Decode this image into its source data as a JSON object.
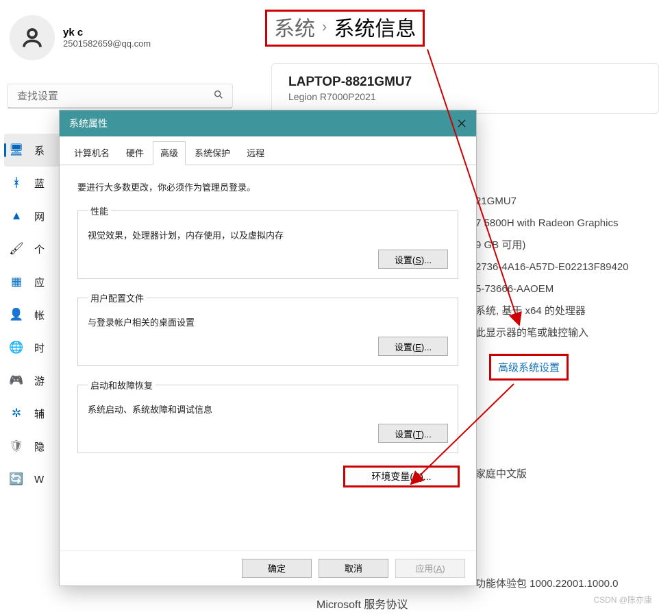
{
  "user": {
    "name": "yk c",
    "email": "2501582659@qq.com"
  },
  "breadcrumb": {
    "parent": "系统",
    "current": "系统信息"
  },
  "search": {
    "placeholder": "查找设置"
  },
  "sidebar": {
    "items": [
      {
        "icon": "💻",
        "label": "系",
        "color": "#0067c0",
        "active": true
      },
      {
        "icon": "B",
        "label": "蓝",
        "color": "#0067c0"
      },
      {
        "icon": "W",
        "label": "网",
        "color": "#0067c0"
      },
      {
        "icon": "🖌",
        "label": "个",
        "color": "#e97627"
      },
      {
        "icon": "▦",
        "label": "应",
        "color": "#0067c0"
      },
      {
        "icon": "👤",
        "label": "帐",
        "color": "#0067c0"
      },
      {
        "icon": "🌐",
        "label": "时",
        "color": "#0067c0"
      },
      {
        "icon": "🎮",
        "label": "游",
        "color": "#666"
      },
      {
        "icon": "✦",
        "label": "辅",
        "color": "#0067c0"
      },
      {
        "icon": "🛡",
        "label": "隐",
        "color": "#777"
      },
      {
        "icon": "🔄",
        "label": "W",
        "color": "#0067c0"
      }
    ]
  },
  "card": {
    "device_name": "LAPTOP-8821GMU7",
    "model": "Legion R7000P2021"
  },
  "info": {
    "lines": [
      "21GMU7",
      "7 5800H with Radeon Graphics",
      "9 GB 可用)",
      "2736-4A16-A57D-E02213F89420",
      "5-73666-AAOEM",
      "系统, 基于 x64 的处理器",
      "此显示器的笔或触控输入"
    ],
    "link": "高级系统设置",
    "edition": "家庭中文版",
    "version": "功能体验包 1000.22001.1000.0",
    "agreement": "Microsoft 服务协议"
  },
  "dialog": {
    "title": "系统属性",
    "tabs": [
      "计算机名",
      "硬件",
      "高级",
      "系统保护",
      "远程"
    ],
    "active_tab": 2,
    "note": "要进行大多数更改，你必须作为管理员登录。",
    "groups": [
      {
        "legend": "性能",
        "desc": "视觉效果，处理器计划，内存使用，以及虚拟内存",
        "button": "设置(S)...",
        "key": "S"
      },
      {
        "legend": "用户配置文件",
        "desc": "与登录帐户相关的桌面设置",
        "button": "设置(E)...",
        "key": "E"
      },
      {
        "legend": "启动和故障恢复",
        "desc": "系统启动、系统故障和调试信息",
        "button": "设置(T)...",
        "key": "T"
      }
    ],
    "env_button_pre": "环境变量(",
    "env_button_key": "N",
    "env_button_post": ")...",
    "footer": {
      "ok": "确定",
      "cancel": "取消",
      "apply": "应用(A)",
      "apply_key": "A"
    }
  },
  "watermark": "CSDN @陈亦康"
}
